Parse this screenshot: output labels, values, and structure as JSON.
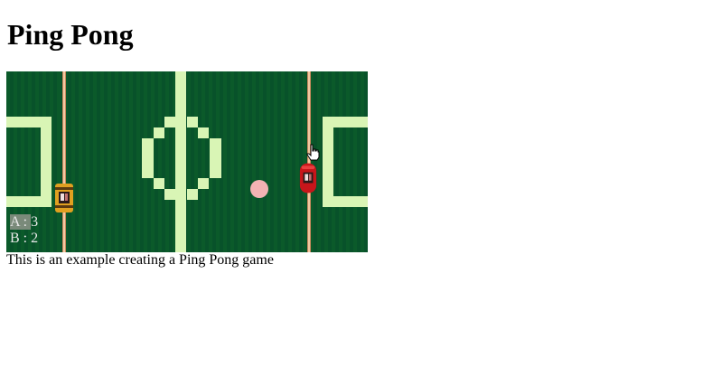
{
  "page": {
    "title": "Ping Pong",
    "caption": "This is an example creating a Ping Pong game"
  },
  "game": {
    "score": {
      "a_label": "A : ",
      "a_value": "3",
      "b_label": "B : ",
      "b_value": "2"
    },
    "colors": {
      "field": "#0b5a2a",
      "lines": "#d9f5b5",
      "ball": "#f4b3b3",
      "paddle_left": "#e0a020",
      "paddle_right": "#c8161b"
    }
  }
}
